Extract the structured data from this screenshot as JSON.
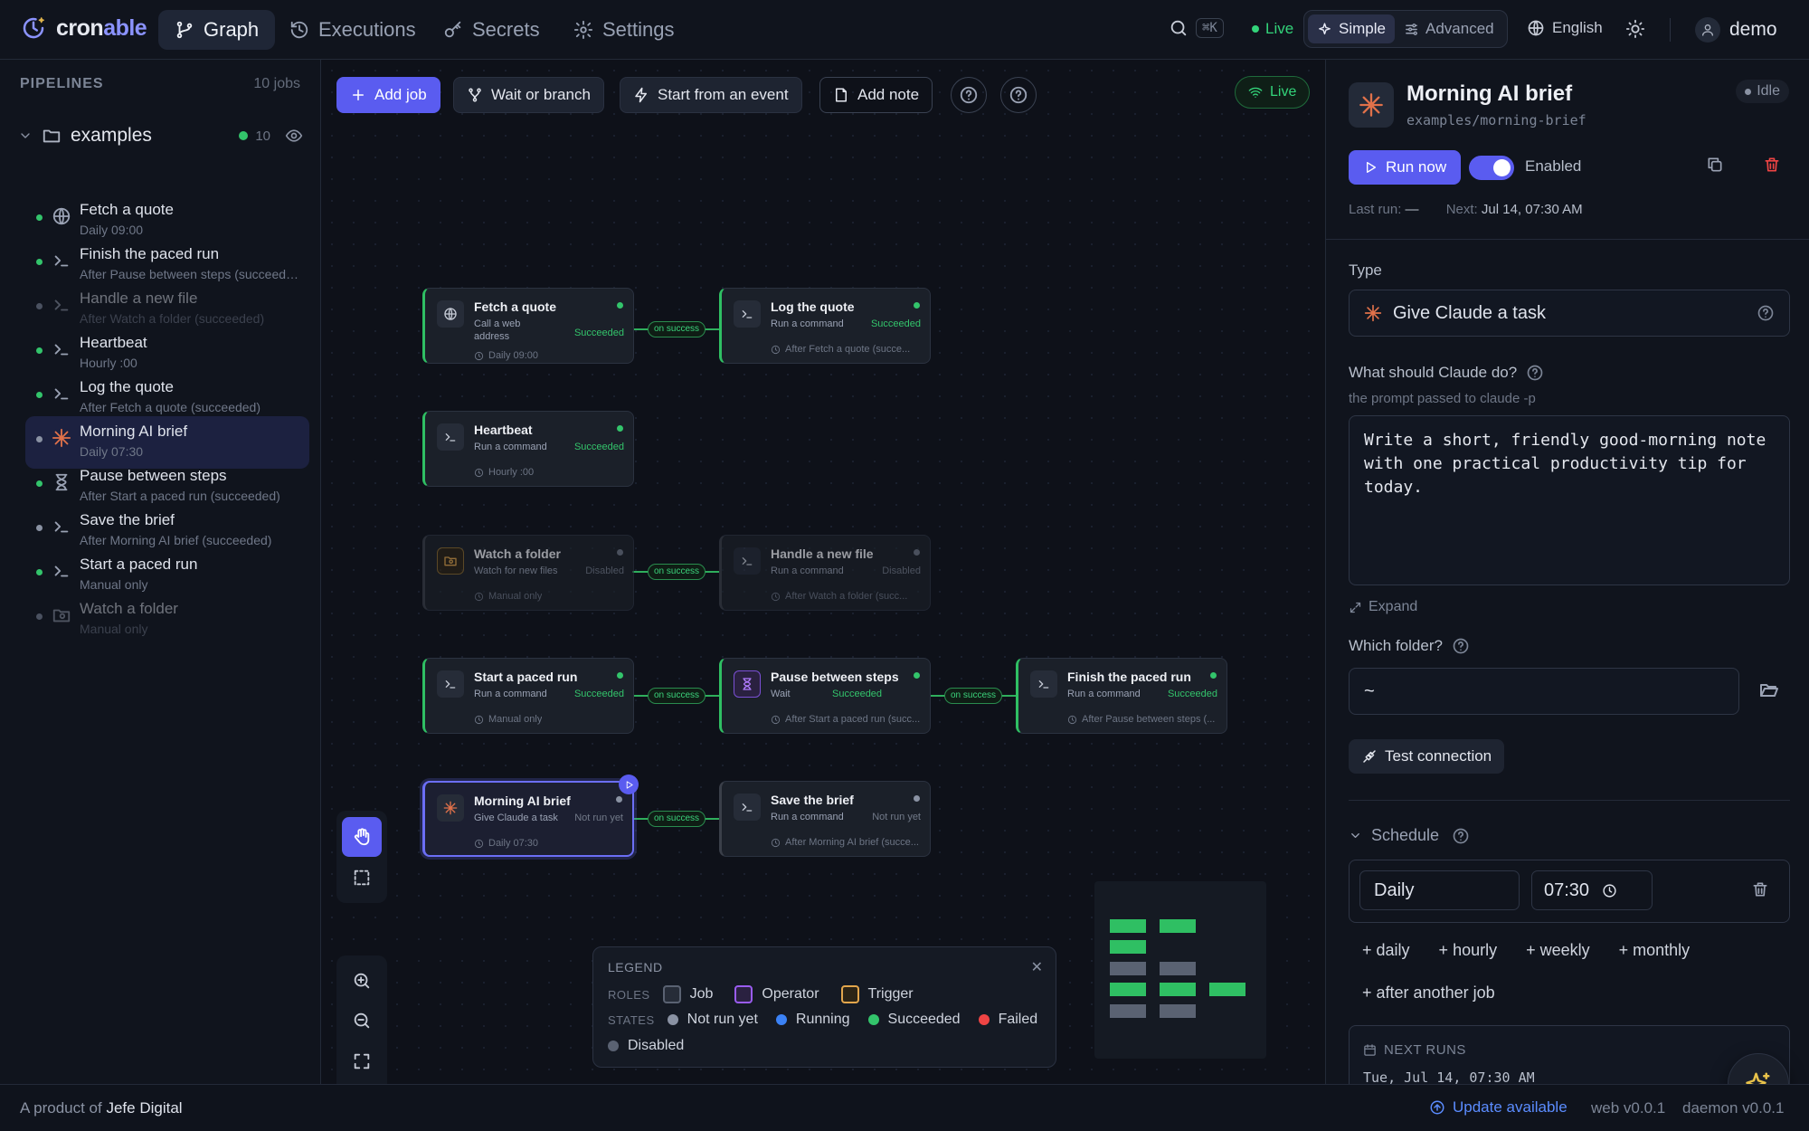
{
  "app": {
    "brand_part1": "cron",
    "brand_part2": "able",
    "accent": "#5a5cf0",
    "success": "#33c46b"
  },
  "nav": {
    "tabs": [
      {
        "label": "Graph",
        "icon": "branch-icon"
      },
      {
        "label": "Executions",
        "icon": "history-icon"
      },
      {
        "label": "Secrets",
        "icon": "key-icon"
      },
      {
        "label": "Settings",
        "icon": "gear-icon"
      }
    ],
    "active": "Graph"
  },
  "topbar": {
    "shortcut": "⌘K",
    "live": "Live",
    "mode_simple": "Simple",
    "mode_advanced": "Advanced",
    "language": "English",
    "user": "demo"
  },
  "sidebar": {
    "heading": "PIPELINES",
    "count": "10 jobs",
    "folder": {
      "name": "examples",
      "count": "10"
    },
    "items": [
      {
        "title": "Fetch a quote",
        "sub": "Daily 09:00",
        "icon": "globe-icon",
        "state": "succeeded"
      },
      {
        "title": "Finish the paced run",
        "sub": "After Pause between steps (succeeded)",
        "icon": "terminal-icon",
        "state": "succeeded"
      },
      {
        "title": "Handle a new file",
        "sub": "After Watch a folder (succeeded)",
        "icon": "terminal-icon",
        "state": "disabled"
      },
      {
        "title": "Heartbeat",
        "sub": "Hourly :00",
        "icon": "terminal-icon",
        "state": "succeeded"
      },
      {
        "title": "Log the quote",
        "sub": "After Fetch a quote (succeeded)",
        "icon": "terminal-icon",
        "state": "succeeded"
      },
      {
        "title": "Morning AI brief",
        "sub": "Daily 07:30",
        "icon": "sparkle-icon",
        "state": "not-run"
      },
      {
        "title": "Pause between steps",
        "sub": "After Start a paced run (succeeded)",
        "icon": "hourglass-icon",
        "state": "succeeded"
      },
      {
        "title": "Save the brief",
        "sub": "After Morning AI brief (succeeded)",
        "icon": "terminal-icon",
        "state": "not-run"
      },
      {
        "title": "Start a paced run",
        "sub": "Manual only",
        "icon": "terminal-icon",
        "state": "succeeded"
      },
      {
        "title": "Watch a folder",
        "sub": "Manual only",
        "icon": "folder-watch-icon",
        "state": "disabled"
      }
    ]
  },
  "toolbar": {
    "add_job": "Add job",
    "wait_branch": "Wait or branch",
    "start_event": "Start from an event",
    "add_note": "Add note",
    "live": "Live"
  },
  "graph": {
    "nodes": {
      "fetch": {
        "title": "Fetch a quote",
        "sub1": "Call a web",
        "sub2": "address",
        "status": "Succeeded",
        "foot": "Daily 09:00"
      },
      "log": {
        "title": "Log the quote",
        "sub": "Run a command",
        "status": "Succeeded",
        "foot": "After Fetch a quote (succe..."
      },
      "heartbeat": {
        "title": "Heartbeat",
        "sub": "Run a command",
        "status": "Succeeded",
        "foot": "Hourly :00"
      },
      "watch": {
        "title": "Watch a folder",
        "sub": "Watch for new files",
        "status": "Disabled",
        "foot": "Manual only"
      },
      "handle": {
        "title": "Handle a new file",
        "sub": "Run a command",
        "status": "Disabled",
        "foot": "After Watch a folder (succ..."
      },
      "start": {
        "title": "Start a paced run",
        "sub": "Run a command",
        "status": "Succeeded",
        "foot": "Manual only"
      },
      "pause": {
        "title": "Pause between steps",
        "sub": "Wait",
        "status": "Succeeded",
        "foot": "After Start a paced run (succ..."
      },
      "finish": {
        "title": "Finish the paced run",
        "sub": "Run a command",
        "status": "Succeeded",
        "foot": "After Pause between steps (..."
      },
      "brief": {
        "title": "Morning AI brief",
        "sub": "Give Claude a task",
        "status": "Not run yet",
        "foot": "Daily 07:30"
      },
      "save": {
        "title": "Save the brief",
        "sub": "Run a command",
        "status": "Not run yet",
        "foot": "After Morning AI brief (succe..."
      }
    },
    "edge_label": "on success"
  },
  "legend": {
    "title": "LEGEND",
    "roles_label": "ROLES",
    "states_label": "STATES",
    "roles": [
      "Job",
      "Operator",
      "Trigger"
    ],
    "states": [
      "Not run yet",
      "Running",
      "Succeeded",
      "Failed",
      "Disabled"
    ]
  },
  "panel": {
    "title": "Morning AI brief",
    "path": "examples/morning-brief",
    "status": "Idle",
    "run_now": "Run now",
    "enabled_label": "Enabled",
    "enabled": true,
    "last_run_label": "Last run:",
    "last_run_value": "—",
    "next_label": "Next:",
    "next_value": "Jul 14, 07:30 AM",
    "type_label": "Type",
    "type_value": "Give Claude a task",
    "prompt_label": "What should Claude do?",
    "prompt_hint": "the prompt passed to claude -p",
    "prompt_value": "Write a short, friendly good-morning note with one practical productivity tip for today.",
    "expand": "Expand",
    "folder_label": "Which folder?",
    "folder_value": "~",
    "test_connection": "Test connection",
    "schedule_label": "Schedule",
    "frequency": "Daily",
    "time": "07:30",
    "add_daily": "daily",
    "add_hourly": "hourly",
    "add_weekly": "weekly",
    "add_monthly": "monthly",
    "add_after": "after another job",
    "next_runs_label": "NEXT RUNS",
    "next_run_1": "Tue, Jul 14, 07:30 AM"
  },
  "footer": {
    "product_prefix": "A product of",
    "company": "Jefe Digital",
    "update": "Update available",
    "web_version": "web v0.0.1",
    "daemon_version": "daemon v0.0.1"
  }
}
